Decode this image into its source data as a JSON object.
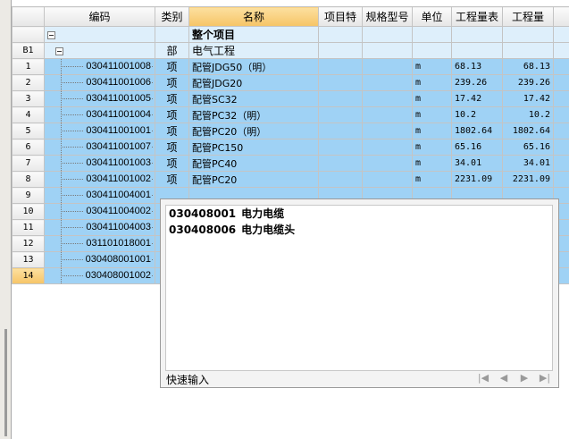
{
  "headers": {
    "code": "编码",
    "type": "类别",
    "name": "名称",
    "feature": "项目特",
    "spec": "规格型号",
    "unit": "单位",
    "qty_expr": "工程量表",
    "qty": "工程量"
  },
  "summary_row": {
    "name": "整个项目"
  },
  "section_row": {
    "id": "B1",
    "type": "部",
    "name": "电气工程"
  },
  "rows": [
    {
      "no": "1",
      "code": "030411001008",
      "type": "项",
      "name": "配管JDG50（明）",
      "unit": "m",
      "expr": "68.13",
      "qty": "68.13"
    },
    {
      "no": "2",
      "code": "030411001006",
      "type": "项",
      "name": "配管JDG20",
      "unit": "m",
      "expr": "239.26",
      "qty": "239.26"
    },
    {
      "no": "3",
      "code": "030411001005",
      "type": "项",
      "name": "配管SC32",
      "unit": "m",
      "expr": "17.42",
      "qty": "17.42"
    },
    {
      "no": "4",
      "code": "030411001004",
      "type": "项",
      "name": "配管PC32（明）",
      "unit": "m",
      "expr": "10.2",
      "qty": "10.2"
    },
    {
      "no": "5",
      "code": "030411001001",
      "type": "项",
      "name": "配管PC20（明）",
      "unit": "m",
      "expr": "1802.64",
      "qty": "1802.64"
    },
    {
      "no": "6",
      "code": "030411001007",
      "type": "项",
      "name": "配管PC150",
      "unit": "m",
      "expr": "65.16",
      "qty": "65.16"
    },
    {
      "no": "7",
      "code": "030411001003",
      "type": "项",
      "name": "配管PC40",
      "unit": "m",
      "expr": "34.01",
      "qty": "34.01"
    },
    {
      "no": "8",
      "code": "030411001002",
      "type": "项",
      "name": "配管PC20",
      "unit": "m",
      "expr": "2231.09",
      "qty": "2231.09"
    },
    {
      "no": "9",
      "code": "030411004001",
      "type": "",
      "name": "",
      "unit": "",
      "expr": "",
      "qty": ""
    },
    {
      "no": "10",
      "code": "030411004002",
      "type": "",
      "name": "",
      "unit": "",
      "expr": "",
      "qty": ""
    },
    {
      "no": "11",
      "code": "030411004003",
      "type": "",
      "name": "",
      "unit": "",
      "expr": "",
      "qty": ""
    },
    {
      "no": "12",
      "code": "031101018001",
      "type": "",
      "name": "",
      "unit": "",
      "expr": "",
      "qty": ""
    },
    {
      "no": "13",
      "code": "030408001001",
      "type": "",
      "name": "",
      "unit": "",
      "expr": "",
      "qty": ""
    },
    {
      "no": "14",
      "code": "030408001002",
      "type": "",
      "name": "",
      "unit": "",
      "expr": "",
      "qty": ""
    }
  ],
  "popup": {
    "items": [
      {
        "code": "030408001",
        "name": "电力电缆"
      },
      {
        "code": "030408006",
        "name": "电力电缆头"
      }
    ],
    "footer_label": "快速输入",
    "nav_icons": [
      "first-icon",
      "prev-icon",
      "next-icon",
      "last-icon"
    ]
  },
  "colors": {
    "selected_row": "#9fd2f5",
    "active_header": "#f6c466"
  }
}
